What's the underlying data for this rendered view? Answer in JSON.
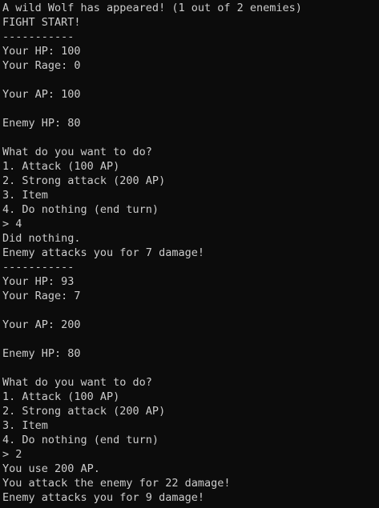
{
  "console": {
    "lines": [
      "A wild Wolf has appeared! (1 out of 2 enemies)",
      "FIGHT START!",
      "-----------",
      "Your HP: 100",
      "Your Rage: 0",
      "",
      "Your AP: 100",
      "",
      "Enemy HP: 80",
      "",
      "What do you want to do?",
      "1. Attack (100 AP)",
      "2. Strong attack (200 AP)",
      "3. Item",
      "4. Do nothing (end turn)",
      "> 4",
      "Did nothing.",
      "Enemy attacks you for 7 damage!",
      "-----------",
      "Your HP: 93",
      "Your Rage: 7",
      "",
      "Your AP: 200",
      "",
      "Enemy HP: 80",
      "",
      "What do you want to do?",
      "1. Attack (100 AP)",
      "2. Strong attack (200 AP)",
      "3. Item",
      "4. Do nothing (end turn)",
      "> 2",
      "You use 200 AP.",
      "You attack the enemy for 22 damage!",
      "Enemy attacks you for 9 damage!"
    ]
  }
}
